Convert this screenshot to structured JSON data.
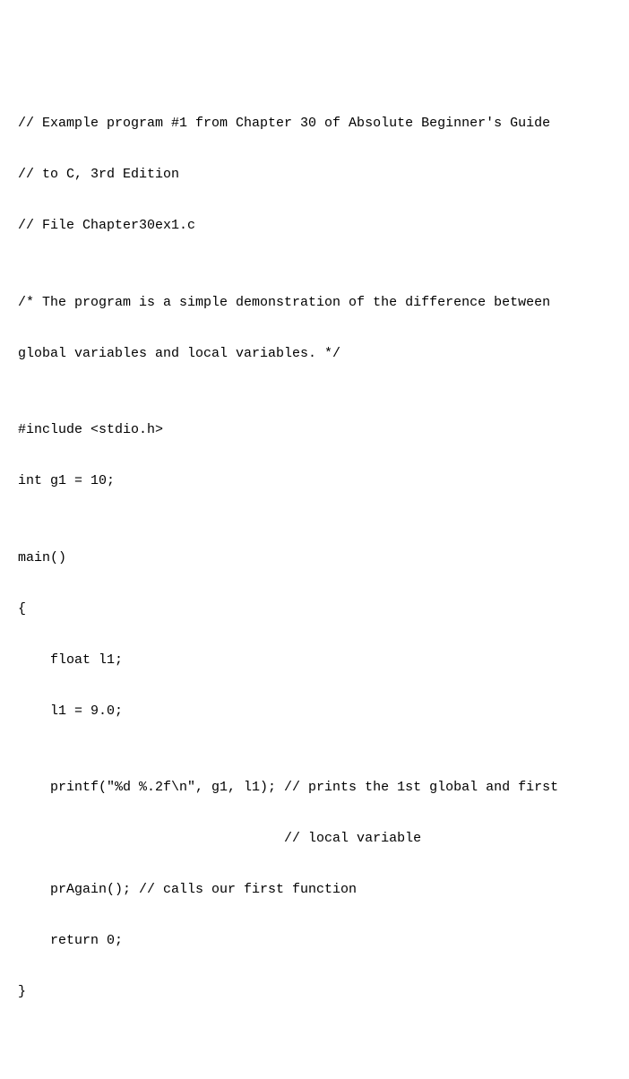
{
  "code": {
    "line1": "// Example program #1 from Chapter 30 of Absolute Beginner's Guide",
    "line2": "// to C, 3rd Edition",
    "line3": "// File Chapter30ex1.c",
    "line4": "",
    "line5": "/* The program is a simple demonstration of the difference between",
    "line6": "global variables and local variables. */",
    "line7": "",
    "line8": "#include <stdio.h>",
    "line9": "int g1 = 10;",
    "line10": "",
    "line11": "main()",
    "line12": "{",
    "line13": "    float l1;",
    "line14": "    l1 = 9.0;",
    "line15": "",
    "line16": "    printf(\"%d %.2f\\n\", g1, l1); // prints the 1st global and first",
    "line17": "                                 // local variable",
    "line18": "    prAgain(); // calls our first function",
    "line19": "    return 0;",
    "line20": "}"
  }
}
